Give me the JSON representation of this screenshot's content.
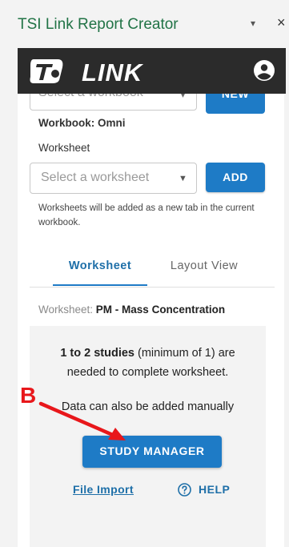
{
  "pane": {
    "title": "TSI Link Report Creator",
    "chevron": "▾",
    "close": "×"
  },
  "header": {
    "logo_text": "LINK"
  },
  "workbook": {
    "select_placeholder": "Select a workbook",
    "caret": "▾",
    "new_label": "NEW",
    "label": "Workbook:",
    "value": "Omni"
  },
  "worksheet": {
    "section_label": "Worksheet",
    "select_placeholder": "Select a worksheet",
    "caret": "▼",
    "add_label": "ADD",
    "hint": "Worksheets will be added as a new tab in the current workbook."
  },
  "tabs": [
    {
      "label": "Worksheet",
      "active": true
    },
    {
      "label": "Layout View",
      "active": false
    }
  ],
  "current": {
    "label": "Worksheet:",
    "value": "PM - Mass Concentration"
  },
  "panel": {
    "studies_bold": "1 to 2 studies",
    "studies_rest": " (minimum of 1) are",
    "studies_line2": "needed to complete worksheet.",
    "manual": "Data can also be added manually",
    "study_manager_label": "STUDY MANAGER",
    "file_import_label": "File Import",
    "help_label": "HELP"
  },
  "annotation": {
    "letter": "B"
  },
  "colors": {
    "accent": "#1e7bc6",
    "header": "#2b2b2b",
    "excel_green": "#217346",
    "annotation": "#e8171b"
  },
  "icons": {
    "logo": "tsi-logo-icon",
    "user": "account-circle-icon",
    "help": "help-circle-icon",
    "arrow": "red-arrow-icon"
  }
}
